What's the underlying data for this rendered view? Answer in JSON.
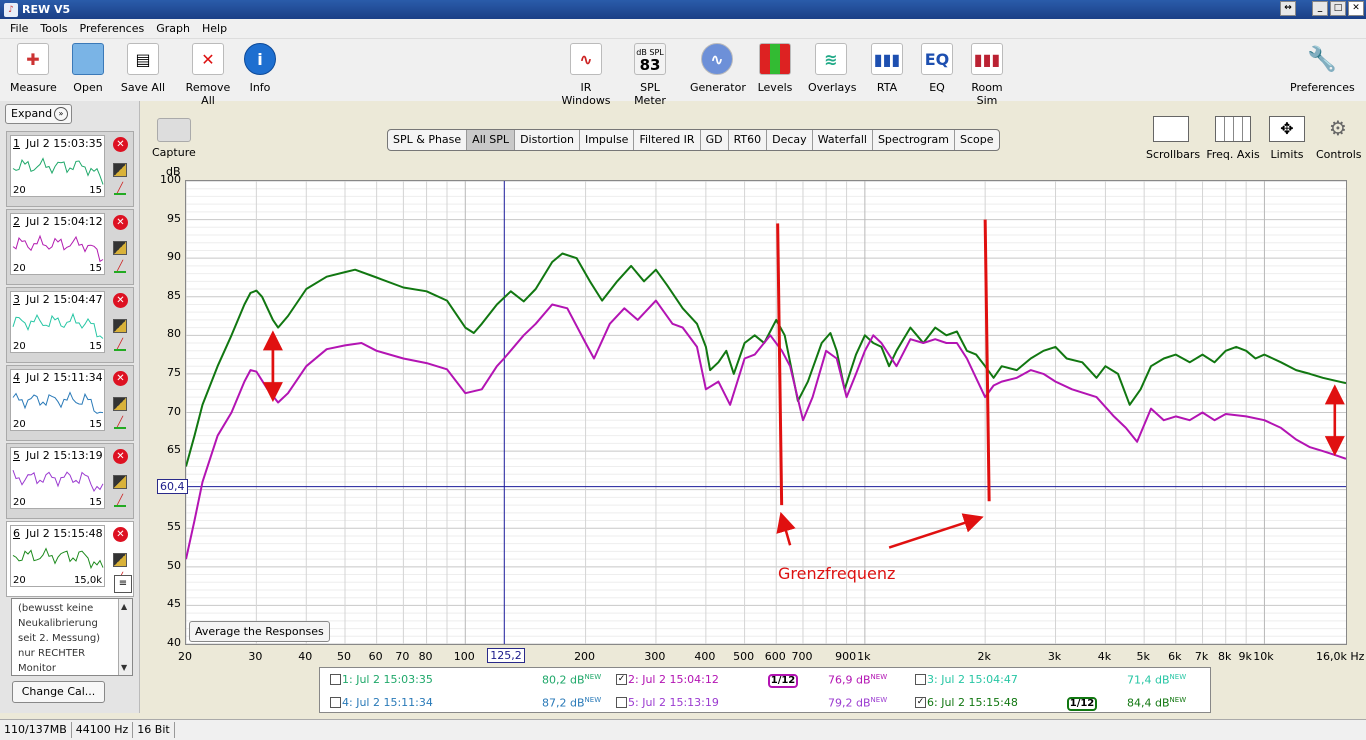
{
  "window": {
    "title": "REW V5"
  },
  "menu": [
    "File",
    "Tools",
    "Preferences",
    "Graph",
    "Help"
  ],
  "toolbar_left": [
    {
      "label": "Measure",
      "icon": "measure-icon"
    },
    {
      "label": "Open",
      "icon": "folder-icon"
    },
    {
      "label": "Save All",
      "icon": "save-icon"
    },
    {
      "label": "Remove All",
      "icon": "remove-icon"
    },
    {
      "label": "Info",
      "icon": "info-icon"
    }
  ],
  "toolbar_center": [
    {
      "label": "IR Windows",
      "icon": "ir-windows-icon"
    },
    {
      "label": "SPL Meter",
      "icon": "spl-meter-icon",
      "badge_top": "dB SPL",
      "badge_value": "83"
    },
    {
      "label": "Generator",
      "icon": "generator-icon"
    },
    {
      "label": "Levels",
      "icon": "levels-icon"
    },
    {
      "label": "Overlays",
      "icon": "overlays-icon"
    },
    {
      "label": "RTA",
      "icon": "rta-icon"
    },
    {
      "label": "EQ",
      "icon": "eq-icon"
    },
    {
      "label": "Room Sim",
      "icon": "room-sim-icon"
    }
  ],
  "toolbar_right": {
    "label": "Preferences",
    "icon": "wrench-icon"
  },
  "expand_label": "Expand",
  "measurements": [
    {
      "num": "1",
      "time": "Jul 2 15:03:35",
      "ax_start": "20",
      "ax_end": "15",
      "color": "#1fa86a"
    },
    {
      "num": "2",
      "time": "Jul 2 15:04:12",
      "ax_start": "20",
      "ax_end": "15",
      "color": "#b21cb0"
    },
    {
      "num": "3",
      "time": "Jul 2 15:04:47",
      "ax_start": "20",
      "ax_end": "15",
      "color": "#27c6a4"
    },
    {
      "num": "4",
      "time": "Jul 2 15:11:34",
      "ax_start": "20",
      "ax_end": "15",
      "color": "#2a7ab8"
    },
    {
      "num": "5",
      "time": "Jul 2 15:13:19",
      "ax_start": "20",
      "ax_end": "15",
      "color": "#9b3bd0"
    },
    {
      "num": "6",
      "time": "Jul 2 15:15:48",
      "ax_start": "20",
      "ax_end": "15,0k",
      "color": "#1c8a1c"
    }
  ],
  "notes": [
    "(bewusst keine",
    "Neukalibrierung",
    "seit 2. Messung)",
    "nur RECHTER",
    "Monitor"
  ],
  "change_cal_label": "Change Cal...",
  "capture_label": "Capture",
  "tabs": [
    "SPL & Phase",
    "All SPL",
    "Distortion",
    "Impulse",
    "Filtered IR",
    "GD",
    "RT60",
    "Decay",
    "Waterfall",
    "Spectrogram",
    "Scope"
  ],
  "active_tab": "All SPL",
  "graph_tools": [
    {
      "label": "Scrollbars",
      "icon": "scrollbars-icon"
    },
    {
      "label": "Freq. Axis",
      "icon": "freq-axis-icon"
    },
    {
      "label": "Limits",
      "icon": "limits-icon"
    },
    {
      "label": "Controls",
      "icon": "gear-icon"
    }
  ],
  "avg_button_label": "Average the Responses",
  "annotation": "Grenzfrequenz",
  "chart_data": {
    "type": "line",
    "ylabel": "dB",
    "ylim": [
      40,
      100
    ],
    "xlim": [
      20,
      16000
    ],
    "xscale": "log",
    "y_ticks": [
      "100",
      "95",
      "90",
      "85",
      "80",
      "75",
      "70",
      "65",
      "60",
      "55",
      "50",
      "45",
      "40"
    ],
    "x_ticks": [
      {
        "v": 20,
        "l": "20"
      },
      {
        "v": 30,
        "l": "30"
      },
      {
        "v": 40,
        "l": "40"
      },
      {
        "v": 50,
        "l": "50"
      },
      {
        "v": 60,
        "l": "60"
      },
      {
        "v": 70,
        "l": "70"
      },
      {
        "v": 80,
        "l": "80"
      },
      {
        "v": 100,
        "l": "100"
      },
      {
        "v": 200,
        "l": "200"
      },
      {
        "v": 300,
        "l": "300"
      },
      {
        "v": 400,
        "l": "400"
      },
      {
        "v": 500,
        "l": "500"
      },
      {
        "v": 600,
        "l": "600"
      },
      {
        "v": 700,
        "l": "700"
      },
      {
        "v": 900,
        "l": "900"
      },
      {
        "v": 1000,
        "l": "1k"
      },
      {
        "v": 2000,
        "l": "2k"
      },
      {
        "v": 3000,
        "l": "3k"
      },
      {
        "v": 4000,
        "l": "4k"
      },
      {
        "v": 5000,
        "l": "5k"
      },
      {
        "v": 6000,
        "l": "6k"
      },
      {
        "v": 7000,
        "l": "7k"
      },
      {
        "v": 8000,
        "l": "8k"
      },
      {
        "v": 9000,
        "l": "9k"
      },
      {
        "v": 10000,
        "l": "10k"
      },
      {
        "v": 16000,
        "l": "16,0k Hz"
      }
    ],
    "cursor": {
      "freq": 125.2,
      "freq_label": "125,2",
      "level": 60.4,
      "level_label": "60,4"
    },
    "series": [
      {
        "id": "6",
        "color": "#117711",
        "points": [
          [
            20,
            63
          ],
          [
            21,
            67
          ],
          [
            22,
            71
          ],
          [
            24,
            76
          ],
          [
            26,
            80
          ],
          [
            28,
            84
          ],
          [
            29,
            85.5
          ],
          [
            30,
            85.8
          ],
          [
            31,
            85
          ],
          [
            33,
            82
          ],
          [
            34,
            81
          ],
          [
            36,
            82.5
          ],
          [
            40,
            86
          ],
          [
            45,
            87.6
          ],
          [
            50,
            88.2
          ],
          [
            53,
            88.5
          ],
          [
            60,
            87.5
          ],
          [
            70,
            86.2
          ],
          [
            80,
            85.7
          ],
          [
            90,
            84.5
          ],
          [
            100,
            81
          ],
          [
            105,
            80.3
          ],
          [
            110,
            81.5
          ],
          [
            120,
            84
          ],
          [
            130,
            85.7
          ],
          [
            140,
            84.4
          ],
          [
            150,
            86
          ],
          [
            165,
            89.5
          ],
          [
            175,
            90.6
          ],
          [
            190,
            90
          ],
          [
            205,
            87
          ],
          [
            220,
            84.5
          ],
          [
            240,
            87
          ],
          [
            260,
            89
          ],
          [
            280,
            87
          ],
          [
            300,
            88.5
          ],
          [
            320,
            86.5
          ],
          [
            350,
            83.5
          ],
          [
            380,
            81.5
          ],
          [
            400,
            78.5
          ],
          [
            410,
            75.5
          ],
          [
            430,
            76.5
          ],
          [
            450,
            78
          ],
          [
            470,
            75
          ],
          [
            500,
            79
          ],
          [
            530,
            80
          ],
          [
            560,
            79
          ],
          [
            600,
            82
          ],
          [
            630,
            80
          ],
          [
            680,
            71.5
          ],
          [
            720,
            74
          ],
          [
            780,
            79
          ],
          [
            820,
            80.3
          ],
          [
            850,
            78
          ],
          [
            890,
            73
          ],
          [
            950,
            77.5
          ],
          [
            1000,
            80
          ],
          [
            1050,
            79
          ],
          [
            1100,
            78.5
          ],
          [
            1150,
            76
          ],
          [
            1200,
            78
          ],
          [
            1300,
            81
          ],
          [
            1350,
            80
          ],
          [
            1400,
            79
          ],
          [
            1500,
            81
          ],
          [
            1600,
            80
          ],
          [
            1700,
            80.5
          ],
          [
            1800,
            78
          ],
          [
            1900,
            77.5
          ],
          [
            2000,
            76
          ],
          [
            2100,
            74.5
          ],
          [
            2200,
            76
          ],
          [
            2400,
            75.5
          ],
          [
            2600,
            77
          ],
          [
            2800,
            78
          ],
          [
            3000,
            78.5
          ],
          [
            3200,
            77
          ],
          [
            3500,
            76.5
          ],
          [
            3800,
            74.5
          ],
          [
            4000,
            76
          ],
          [
            4300,
            75
          ],
          [
            4600,
            71
          ],
          [
            4900,
            73
          ],
          [
            5200,
            76
          ],
          [
            5600,
            77
          ],
          [
            6000,
            77.5
          ],
          [
            6500,
            76.5
          ],
          [
            7000,
            77.5
          ],
          [
            7500,
            76.5
          ],
          [
            8000,
            78
          ],
          [
            8500,
            78.5
          ],
          [
            9000,
            78
          ],
          [
            9500,
            77
          ],
          [
            10000,
            77.5
          ],
          [
            11000,
            76.5
          ],
          [
            12000,
            75.5
          ],
          [
            13000,
            75
          ],
          [
            14000,
            74.5
          ],
          [
            16000,
            73.8
          ]
        ]
      },
      {
        "id": "2",
        "color": "#b314b3",
        "points": [
          [
            20,
            51
          ],
          [
            21,
            56
          ],
          [
            22,
            61
          ],
          [
            24,
            67
          ],
          [
            26,
            70
          ],
          [
            28,
            74
          ],
          [
            29,
            75.5
          ],
          [
            30,
            75.3
          ],
          [
            32,
            73
          ],
          [
            34,
            71.3
          ],
          [
            36,
            72.5
          ],
          [
            40,
            76
          ],
          [
            45,
            78.2
          ],
          [
            50,
            78.7
          ],
          [
            55,
            79
          ],
          [
            60,
            78
          ],
          [
            70,
            77
          ],
          [
            80,
            76.4
          ],
          [
            90,
            75.6
          ],
          [
            100,
            72.5
          ],
          [
            110,
            73
          ],
          [
            120,
            76
          ],
          [
            125,
            77
          ],
          [
            140,
            80
          ],
          [
            150,
            81.5
          ],
          [
            165,
            84
          ],
          [
            180,
            83.5
          ],
          [
            200,
            79
          ],
          [
            210,
            77
          ],
          [
            230,
            81.5
          ],
          [
            250,
            83.5
          ],
          [
            270,
            82
          ],
          [
            300,
            84.5
          ],
          [
            330,
            81.5
          ],
          [
            350,
            81
          ],
          [
            380,
            78.5
          ],
          [
            400,
            73
          ],
          [
            430,
            74
          ],
          [
            460,
            71
          ],
          [
            500,
            77
          ],
          [
            530,
            77.5
          ],
          [
            580,
            80
          ],
          [
            620,
            78
          ],
          [
            650,
            76
          ],
          [
            700,
            69
          ],
          [
            740,
            72
          ],
          [
            800,
            78
          ],
          [
            850,
            77
          ],
          [
            900,
            72
          ],
          [
            950,
            75
          ],
          [
            1000,
            78
          ],
          [
            1050,
            80
          ],
          [
            1100,
            79
          ],
          [
            1200,
            76
          ],
          [
            1300,
            79.5
          ],
          [
            1400,
            79
          ],
          [
            1500,
            79.5
          ],
          [
            1600,
            79
          ],
          [
            1700,
            79
          ],
          [
            1800,
            77
          ],
          [
            2000,
            72
          ],
          [
            2100,
            73.5
          ],
          [
            2200,
            74
          ],
          [
            2400,
            74.5
          ],
          [
            2600,
            75.5
          ],
          [
            2800,
            75
          ],
          [
            3000,
            74
          ],
          [
            3300,
            73
          ],
          [
            3800,
            72
          ],
          [
            4200,
            69.5
          ],
          [
            4500,
            68
          ],
          [
            4800,
            66.2
          ],
          [
            5200,
            70.5
          ],
          [
            5600,
            69
          ],
          [
            6000,
            69.5
          ],
          [
            6500,
            69
          ],
          [
            7000,
            70
          ],
          [
            7500,
            69
          ],
          [
            8000,
            69.8
          ],
          [
            9000,
            69.5
          ],
          [
            10000,
            69
          ],
          [
            11000,
            68
          ],
          [
            12000,
            66.5
          ],
          [
            13000,
            65.5
          ],
          [
            14000,
            65
          ],
          [
            15000,
            64.5
          ],
          [
            16000,
            64
          ]
        ]
      }
    ],
    "annotations": [
      {
        "type": "vline",
        "x": 605,
        "y1": 94.5,
        "y2": 58,
        "color": "#e01010"
      },
      {
        "type": "vline",
        "x": 2000,
        "y1": 95,
        "y2": 58.5,
        "color": "#e01010"
      },
      {
        "type": "arrow",
        "x1": 33,
        "y1": 72,
        "x2": 33,
        "y2": 80,
        "color": "#e01010"
      },
      {
        "type": "arrow",
        "x1": 33,
        "y1": 80,
        "x2": 33,
        "y2": 72,
        "color": "#e01010"
      },
      {
        "type": "arrow",
        "x1": 15000,
        "y1": 65,
        "x2": 15000,
        "y2": 73,
        "color": "#e01010"
      },
      {
        "type": "arrow",
        "x1": 15000,
        "y1": 73,
        "x2": 15000,
        "y2": 65,
        "color": "#e01010"
      },
      {
        "type": "arrow",
        "x1": 650,
        "y1": 52.8,
        "x2": 620,
        "y2": 56.5,
        "color": "#e01010"
      },
      {
        "type": "arrow",
        "x1": 1150,
        "y1": 52.5,
        "x2": 1930,
        "y2": 56.3,
        "color": "#e01010"
      }
    ]
  },
  "legend": [
    {
      "checked": false,
      "label": "1: Jul 2 15:03:35",
      "value": "80,2 dB",
      "sup": "NEW",
      "color": "#1fa86a",
      "smoothing": ""
    },
    {
      "checked": true,
      "label": "2: Jul 2 15:04:12",
      "value": "76,9 dB",
      "sup": "NEW",
      "color": "#b314b3",
      "smoothing": "1/12"
    },
    {
      "checked": false,
      "label": "3: Jul 2 15:04:47",
      "value": "71,4 dB",
      "sup": "NEW",
      "color": "#27c6a4",
      "smoothing": ""
    },
    {
      "checked": false,
      "label": "4: Jul 2 15:11:34",
      "value": "87,2 dB",
      "sup": "NEW",
      "color": "#2a7ab8",
      "smoothing": ""
    },
    {
      "checked": false,
      "label": "5: Jul 2 15:13:19",
      "value": "79,2 dB",
      "sup": "NEW",
      "color": "#9b3bd0",
      "smoothing": ""
    },
    {
      "checked": true,
      "label": "6: Jul 2 15:15:48",
      "value": "84,4 dB",
      "sup": "NEW",
      "color": "#117711",
      "smoothing": "1/12"
    }
  ],
  "status": [
    "110/137MB",
    "44100 Hz",
    "16 Bit"
  ]
}
